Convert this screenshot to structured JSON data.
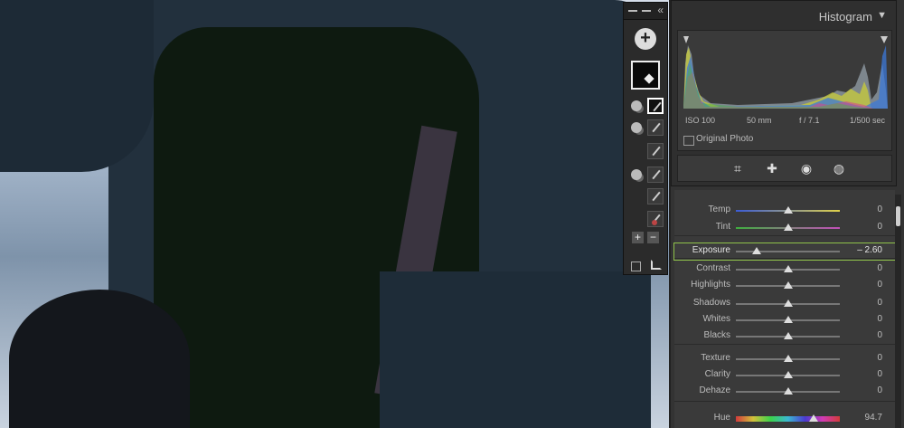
{
  "histogram": {
    "title": "Histogram",
    "meta": {
      "iso": "ISO 100",
      "focal": "50 mm",
      "aperture": "f / 7.1",
      "shutter": "1/500 sec"
    },
    "original_photo_label": "Original Photo"
  },
  "toolbar": {
    "icons": [
      "crop-icon",
      "healing-icon",
      "red-eye-icon",
      "masking-icon"
    ]
  },
  "adjustments": {
    "rows": [
      {
        "label": "Temp",
        "value": "0",
        "level": 0.5,
        "track": "temp"
      },
      {
        "label": "Tint",
        "value": "0",
        "level": 0.5,
        "track": "tint"
      },
      {
        "label": "Exposure",
        "value": "– 2.60",
        "level": 0.2,
        "track": "plain",
        "highlight": true
      },
      {
        "label": "Contrast",
        "value": "0",
        "level": 0.5,
        "track": "plain"
      },
      {
        "label": "Highlights",
        "value": "0",
        "level": 0.5,
        "track": "plain"
      },
      {
        "label": "Shadows",
        "value": "0",
        "level": 0.5,
        "track": "plain"
      },
      {
        "label": "Whites",
        "value": "0",
        "level": 0.5,
        "track": "plain"
      },
      {
        "label": "Blacks",
        "value": "0",
        "level": 0.5,
        "track": "plain"
      },
      {
        "label": "Texture",
        "value": "0",
        "level": 0.5,
        "track": "plain"
      },
      {
        "label": "Clarity",
        "value": "0",
        "level": 0.5,
        "track": "plain"
      },
      {
        "label": "Dehaze",
        "value": "0",
        "level": 0.5,
        "track": "plain"
      },
      {
        "label": "Hue",
        "value": "94.7",
        "level": 0.75,
        "track": "hue"
      }
    ]
  },
  "colors": {
    "highlight": "#8fc24a",
    "panel": "#333333",
    "mask_overlay": "#0e1a10"
  }
}
